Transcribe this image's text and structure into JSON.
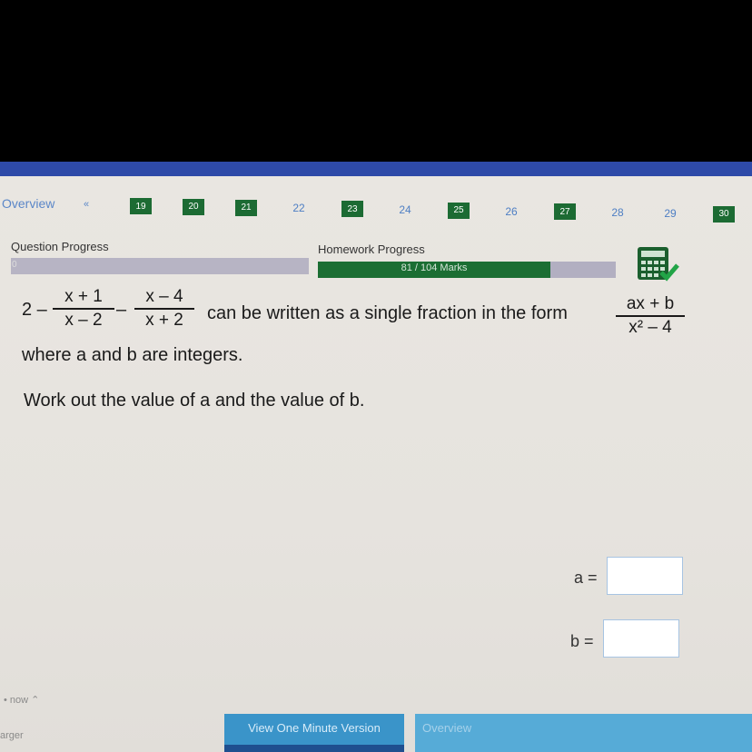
{
  "nav": {
    "overview": "Overview",
    "prev": "«",
    "items": [
      {
        "label": "19",
        "done": true
      },
      {
        "label": "20",
        "done": true
      },
      {
        "label": "21",
        "done": true
      },
      {
        "label": "22",
        "done": false
      },
      {
        "label": "23",
        "done": true
      },
      {
        "label": "24",
        "done": false
      },
      {
        "label": "25",
        "done": true
      },
      {
        "label": "26",
        "done": false
      },
      {
        "label": "27",
        "done": true
      },
      {
        "label": "28",
        "done": false
      },
      {
        "label": "29",
        "done": false
      },
      {
        "label": "30",
        "done": true
      }
    ]
  },
  "progress": {
    "question_label": "Question Progress",
    "question_value": "0",
    "homework_label": "Homework Progress",
    "homework_text": "81 / 104 Marks",
    "homework_fraction": 0.779
  },
  "question": {
    "lead": "2 –",
    "f1_num": "x + 1",
    "f1_den": "x – 2",
    "minus": "–",
    "f2_num": "x – 4",
    "f2_den": "x + 2",
    "text1": "can be written as a single fraction in the form",
    "f3_num": "ax + b",
    "f3_den": "x² – 4",
    "line2": "where a and b are integers.",
    "line3": "Work out the value of a and the value of b."
  },
  "answers": {
    "a_label": "a =",
    "a_value": "",
    "b_label": "b =",
    "b_value": ""
  },
  "footer": {
    "now": "• now ⌃",
    "larger": "arger",
    "view_button": "View One Minute Version",
    "overview_button": "Overview"
  },
  "colors": {
    "done": "#1c6b33",
    "link": "#5b87c8",
    "bar": "#b2afc1"
  }
}
